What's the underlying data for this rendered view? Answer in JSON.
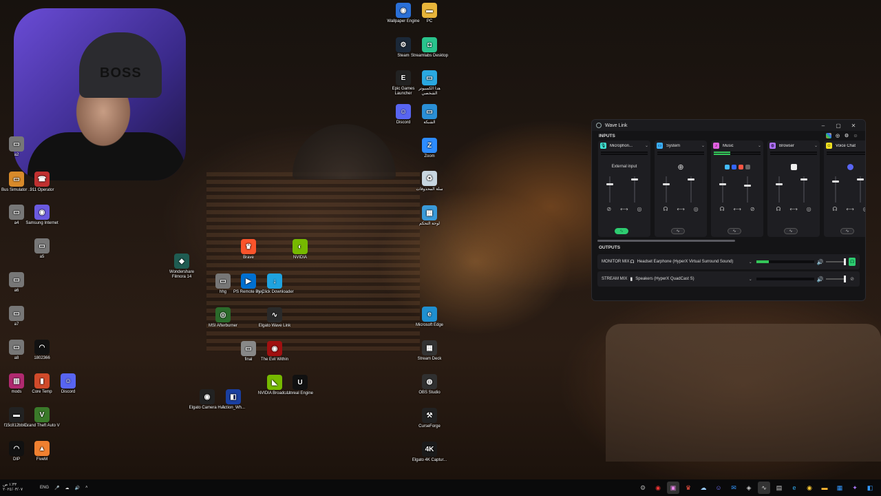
{
  "desktop": {
    "icons": [
      {
        "label": "Wallpaper Engine",
        "glyph": "◉",
        "color": "#2a6fd6",
        "icon": "wallpaper-engine-icon"
      },
      {
        "label": "PC",
        "glyph": "▬",
        "color": "#e8b53a",
        "icon": "folder-icon"
      },
      {
        "label": "Steam",
        "glyph": "⚙",
        "color": "#1b2838",
        "icon": "steam-icon"
      },
      {
        "label": "Streamlabs Desktop",
        "glyph": "◘",
        "color": "#29c38c",
        "icon": "streamlabs-icon"
      },
      {
        "label": "Epic Games Launcher",
        "glyph": "E",
        "color": "#222",
        "icon": "epic-games-icon"
      },
      {
        "label": "هذا الكمبيوتر الشخصي",
        "glyph": "▭",
        "color": "#2aa8e0",
        "icon": "this-pc-icon"
      },
      {
        "label": "Discord",
        "glyph": "☺",
        "color": "#5865f2",
        "icon": "discord-icon"
      },
      {
        "label": "الشبكة",
        "glyph": "▭",
        "color": "#2a8fd6",
        "icon": "network-icon"
      },
      {
        "label": "Zoom",
        "glyph": "Z",
        "color": "#2d8cff",
        "icon": "zoom-icon"
      },
      {
        "label": "سلة المحذوفات",
        "glyph": "♻",
        "color": "#c8d6e0",
        "icon": "recycle-bin-icon"
      },
      {
        "label": "لوحة التحكم",
        "glyph": "▦",
        "color": "#3a9ad9",
        "icon": "control-panel-icon"
      },
      {
        "label": "Microsoft Edge",
        "glyph": "e",
        "color": "#1f8fd0",
        "icon": "edge-icon"
      },
      {
        "label": "Stream Deck",
        "glyph": "▦",
        "color": "#333",
        "icon": "stream-deck-icon"
      },
      {
        "label": "OBS Studio",
        "glyph": "◍",
        "color": "#303030",
        "icon": "obs-icon"
      },
      {
        "label": "CurseForge",
        "glyph": "⚒",
        "color": "#222",
        "icon": "curseforge-icon"
      },
      {
        "label": "Elgato 4K Captur...",
        "glyph": "4K",
        "color": "#1a1a1a",
        "icon": "elgato-4k-icon"
      },
      {
        "label": "Brave",
        "glyph": "♛",
        "color": "#fb542b",
        "icon": "brave-icon"
      },
      {
        "label": "NVIDIA",
        "glyph": "◐",
        "color": "#76b900",
        "icon": "nvidia-icon"
      },
      {
        "label": "Wondershare Filmora 14",
        "glyph": "◆",
        "color": "#1f5c52",
        "icon": "filmora-icon"
      },
      {
        "label": "hhg",
        "glyph": "▭",
        "color": "#777",
        "icon": "image-file-icon"
      },
      {
        "label": "PS Remote Play",
        "glyph": "▶",
        "color": "#0070d1",
        "icon": "ps-remote-play-icon"
      },
      {
        "label": "By Click Downloader",
        "glyph": "↓",
        "color": "#1fa3e0",
        "icon": "byclick-icon"
      },
      {
        "label": "MSI Afterburner",
        "glyph": "◎",
        "color": "#2b6b2b",
        "icon": "msi-afterburner-icon"
      },
      {
        "label": "Elgato Wave Link",
        "glyph": "∿",
        "color": "#2a2a2a",
        "icon": "wave-link-icon"
      },
      {
        "label": "final",
        "glyph": "▭",
        "color": "#888",
        "icon": "image-file-icon"
      },
      {
        "label": "The Evil Within",
        "glyph": "◉",
        "color": "#a01010",
        "icon": "evil-within-icon"
      },
      {
        "label": "Elgato Camera Hub",
        "glyph": "◉",
        "color": "#222",
        "icon": "camera-hub-icon"
      },
      {
        "label": "Action_Wh...",
        "glyph": "◧",
        "color": "#1a3fa0",
        "icon": "shortcut-icon"
      },
      {
        "label": "NVIDIA Broadcast",
        "glyph": "◣",
        "color": "#76b900",
        "icon": "nvidia-broadcast-icon"
      },
      {
        "label": "Unreal Engine",
        "glyph": "U",
        "color": "#111",
        "icon": "unreal-engine-icon"
      },
      {
        "label": "Bus Simulator ...",
        "glyph": "▭",
        "color": "#d88a2a",
        "icon": "bus-simulator-icon"
      },
      {
        "label": "911 Operator",
        "glyph": "☎",
        "color": "#c03030",
        "icon": "operator-icon"
      },
      {
        "label": "a4",
        "glyph": "▭",
        "color": "#777",
        "icon": "image-file-icon"
      },
      {
        "label": "Samsung Internet",
        "glyph": "◉",
        "color": "#6a5ae0",
        "icon": "samsung-internet-icon"
      },
      {
        "label": "a5",
        "glyph": "▭",
        "color": "#777",
        "icon": "image-file-icon"
      },
      {
        "label": "a6",
        "glyph": "▭",
        "color": "#777",
        "icon": "image-file-icon"
      },
      {
        "label": "a7",
        "glyph": "▭",
        "color": "#777",
        "icon": "image-file-icon"
      },
      {
        "label": "a8",
        "glyph": "▭",
        "color": "#777",
        "icon": "image-file-icon"
      },
      {
        "label": "1802366",
        "glyph": "◠",
        "color": "#111",
        "icon": "mask-icon"
      },
      {
        "label": "mods",
        "glyph": "▥",
        "color": "#b02a70",
        "icon": "winrar-icon"
      },
      {
        "label": "Core Temp",
        "glyph": "▮",
        "color": "#d04a2a",
        "icon": "core-temp-icon"
      },
      {
        "label": "Discord",
        "glyph": "☺",
        "color": "#5865f2",
        "icon": "discord-icon"
      },
      {
        "label": "f15c812bb8...",
        "glyph": "▬",
        "color": "#222",
        "icon": "file-icon"
      },
      {
        "label": "Grand Theft Auto V",
        "glyph": "V",
        "color": "#3a7a2a",
        "icon": "gta-icon"
      },
      {
        "label": "DIP",
        "glyph": "◠",
        "color": "#111",
        "icon": "mask-icon"
      },
      {
        "label": "FiveM",
        "glyph": "▲",
        "color": "#f08030",
        "icon": "fivem-icon"
      },
      {
        "label": "a2",
        "glyph": "▭",
        "color": "#777",
        "icon": "image-file-icon"
      }
    ]
  },
  "wavelink": {
    "title": "Wave Link",
    "inputs_label": "INPUTS",
    "outputs_label": "OUTPUTS",
    "channels": [
      {
        "name": "Microphon...",
        "color": "#3fe0d0",
        "glyph": "🎙",
        "source": "External input",
        "level": 0,
        "mix_on": true
      },
      {
        "name": "System",
        "color": "#3ab0ff",
        "glyph": "▭",
        "source": "⊕",
        "level": 0,
        "mix_on": false
      },
      {
        "name": "Music",
        "color": "#e060e0",
        "glyph": "♪",
        "source": "",
        "level": 0.35,
        "mix_on": false
      },
      {
        "name": "Browser",
        "color": "#b070ff",
        "glyph": "◍",
        "source": "",
        "level": 0,
        "mix_on": false
      },
      {
        "name": "Voice Chat",
        "color": "#f0e020",
        "glyph": "☺",
        "source": "",
        "level": 0,
        "mix_on": false
      }
    ],
    "outputs": [
      {
        "label": "MONITOR MIX",
        "device": "Headset Earphone (HyperX Virtual Surround Sound)",
        "level": 0.22,
        "hp_on": true
      },
      {
        "label": "STREAM MIX",
        "device": "Speakers (HyperX QuadCast S)",
        "level": 0,
        "hp_on": false
      }
    ]
  },
  "taskbar": {
    "time": "١:٣٣ ص",
    "date": "٢٠٢٤/٠٣/٠٧",
    "lang": "ENG"
  },
  "webcam": {
    "cap_text": "BOSS"
  }
}
